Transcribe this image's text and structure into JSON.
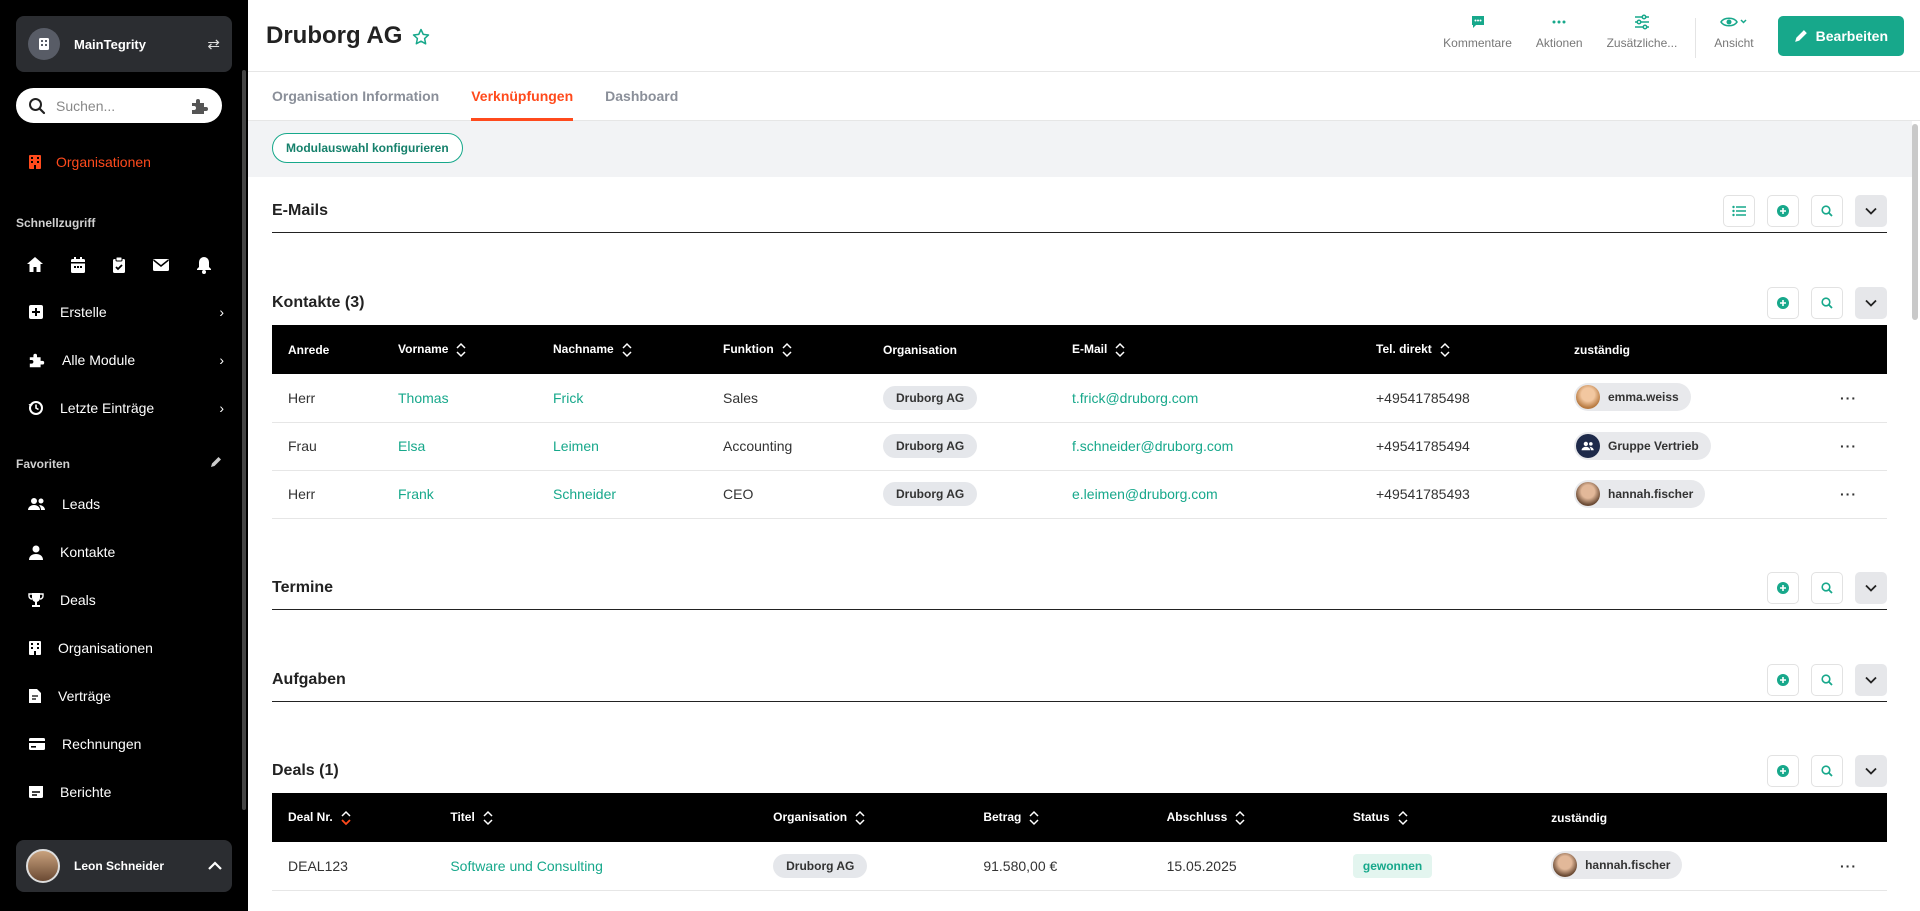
{
  "sidebar": {
    "workspace": "MainTegrity",
    "search_placeholder": "Suchen...",
    "active": "Organisationen",
    "schnellzugriff": "Schnellzugriff",
    "quick_icons": [
      "home-icon",
      "calendar-icon",
      "clipboard-icon",
      "mail-icon",
      "bell-icon"
    ],
    "menu": [
      {
        "label": "Erstelle"
      },
      {
        "label": "Alle Module"
      },
      {
        "label": "Letzte Einträge"
      }
    ],
    "favoriten": "Favoriten",
    "favorites": [
      {
        "label": "Leads"
      },
      {
        "label": "Kontakte"
      },
      {
        "label": "Deals"
      },
      {
        "label": "Organisationen"
      },
      {
        "label": "Verträge"
      },
      {
        "label": "Rechnungen"
      },
      {
        "label": "Berichte"
      }
    ],
    "user": "Leon Schneider"
  },
  "header": {
    "title": "Druborg AG",
    "actions": [
      {
        "label": "Kommentare"
      },
      {
        "label": "Aktionen"
      },
      {
        "label": "Zusätzliche..."
      },
      {
        "label": "Ansicht"
      }
    ],
    "edit": "Bearbeiten"
  },
  "tabs": [
    "Organisation Information",
    "Verknüpfungen",
    "Dashboard"
  ],
  "active_tab": "Verknüpfungen",
  "config_button": "Modulauswahl konfigurieren",
  "sections": {
    "emails": "E-Mails",
    "kontakte": "Kontakte (3)",
    "termine": "Termine",
    "aufgaben": "Aufgaben",
    "deals": "Deals (1)"
  },
  "contacts": {
    "columns": [
      "Anrede",
      "Vorname",
      "Nachname",
      "Funktion",
      "Organisation",
      "E-Mail",
      "Tel. direkt",
      "zuständig"
    ],
    "rows": [
      {
        "anrede": "Herr",
        "vorname": "Thomas",
        "nachname": "Frick",
        "funktion": "Sales",
        "org": "Druborg AG",
        "email": "t.frick@druborg.com",
        "tel": "+49541785498",
        "owner": "emma.weiss"
      },
      {
        "anrede": "Frau",
        "vorname": "Elsa",
        "nachname": "Leimen",
        "funktion": "Accounting",
        "org": "Druborg AG",
        "email": "f.schneider@druborg.com",
        "tel": "+49541785494",
        "owner": "Gruppe Vertrieb"
      },
      {
        "anrede": "Herr",
        "vorname": "Frank",
        "nachname": "Schneider",
        "funktion": "CEO",
        "org": "Druborg AG",
        "email": "e.leimen@druborg.com",
        "tel": "+49541785493",
        "owner": "hannah.fischer"
      }
    ]
  },
  "deals": {
    "columns": [
      "Deal Nr.",
      "Titel",
      "Organisation",
      "Betrag",
      "Abschluss",
      "Status",
      "zuständig"
    ],
    "rows": [
      {
        "nr": "DEAL123",
        "titel": "Software und Consulting",
        "org": "Druborg AG",
        "betrag": "91.580,00 €",
        "abschluss": "15.05.2025",
        "status": "gewonnen",
        "owner": "hannah.fischer"
      }
    ]
  },
  "colors": {
    "accent": "#17a88b",
    "active": "#ff4a1c",
    "sidebar": "#000000"
  }
}
